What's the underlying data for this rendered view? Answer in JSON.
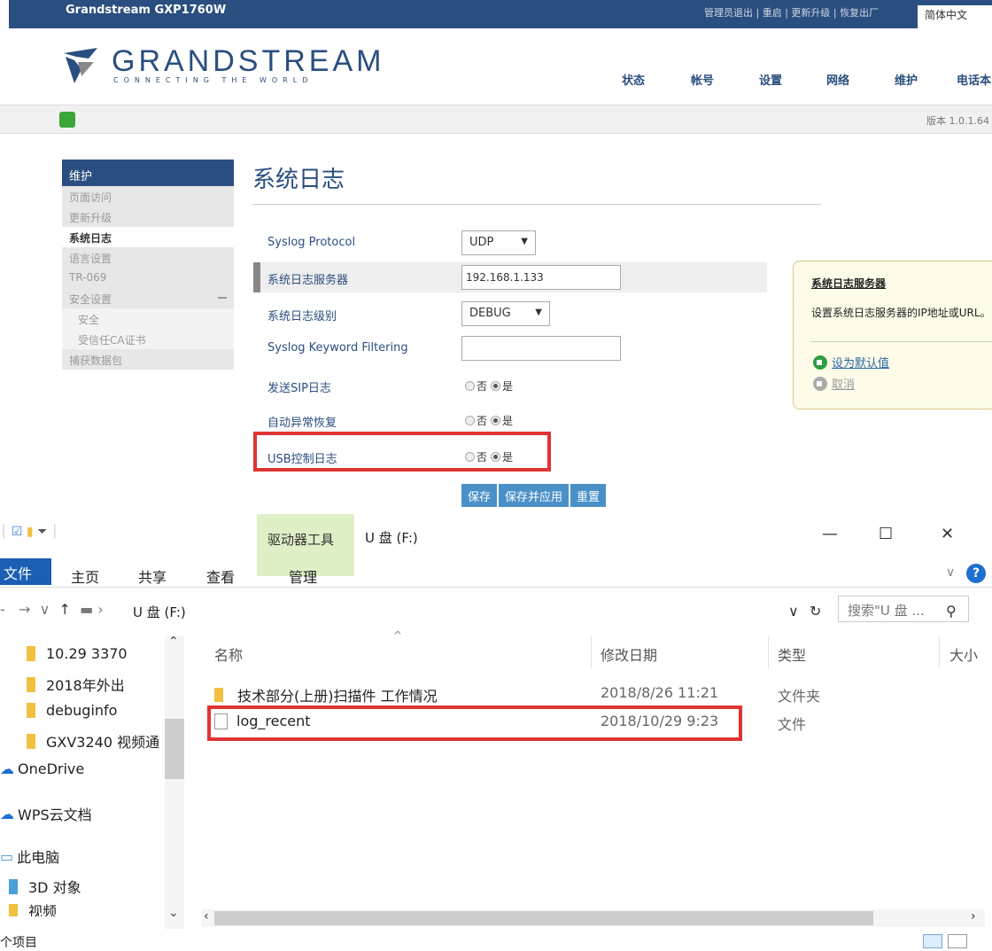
{
  "gs": {
    "model": "Grandstream GXP1760W",
    "top_links": "管理员退出 | 重启 | 更新升级 | 恢复出厂",
    "language": "简体中文",
    "logo_word": "GRANDSTREAM",
    "logo_tag": "CONNECTING THE WORLD",
    "nav": [
      "状态",
      "帐号",
      "设置",
      "网络",
      "维护",
      "电话本"
    ],
    "version": "版本 1.0.1.64"
  },
  "sidebar": {
    "head": "维护",
    "items": [
      "页面访问",
      "更新升级",
      "系统日志",
      "语言设置",
      "TR-069",
      "安全设置",
      "安全",
      "受信任CA证书",
      "捕获数据包"
    ]
  },
  "page": {
    "title": "系统日志"
  },
  "form": {
    "protocol": {
      "label": "Syslog Protocol",
      "value": "UDP"
    },
    "server": {
      "label": "系统日志服务器",
      "value": "192.168.1.133"
    },
    "level": {
      "label": "系统日志级别",
      "value": "DEBUG"
    },
    "keyword": {
      "label": "Syslog Keyword Filtering",
      "value": ""
    },
    "sip": {
      "label": "发送SIP日志",
      "no": "否",
      "yes": "是"
    },
    "recover": {
      "label": "自动异常恢复",
      "no": "否",
      "yes": "是"
    },
    "usb": {
      "label": "USB控制日志",
      "no": "否",
      "yes": "是"
    }
  },
  "buttons": {
    "save": "保存",
    "save_apply": "保存并应用",
    "reset": "重置"
  },
  "tooltip": {
    "title": "系统日志服务器",
    "desc": "设置系统日志服务器的IP地址或URL。",
    "default": "设为默认值",
    "cancel": "取消"
  },
  "explorer": {
    "context_tab": "驱动器工具",
    "window_title": "U 盘 (F:)",
    "manage_tab": "管理",
    "ribbon_tabs": [
      "文件",
      "主页",
      "共享",
      "查看"
    ],
    "breadcrumb": "U 盘 (F:)",
    "search_placeholder": "搜索\"U 盘 ...",
    "nav_items": [
      "10.29 3370",
      "2018年外出",
      "debuginfo",
      "GXV3240 视频通",
      "OneDrive",
      "WPS云文档",
      "此电脑",
      "3D 对象",
      "视频"
    ],
    "columns": [
      "名称",
      "修改日期",
      "类型",
      "大小"
    ],
    "files": [
      {
        "name": "技术部分(上册)扫描件 工作情况",
        "date": "2018/8/26 11:21",
        "type": "文件夹"
      },
      {
        "name": "log_recent",
        "date": "2018/10/29 9:23",
        "type": "文件"
      }
    ],
    "status": "个项目"
  },
  "colors": {
    "brand": "#2a4e7f",
    "highlight": "#e03434",
    "button": "#4a90c8"
  }
}
